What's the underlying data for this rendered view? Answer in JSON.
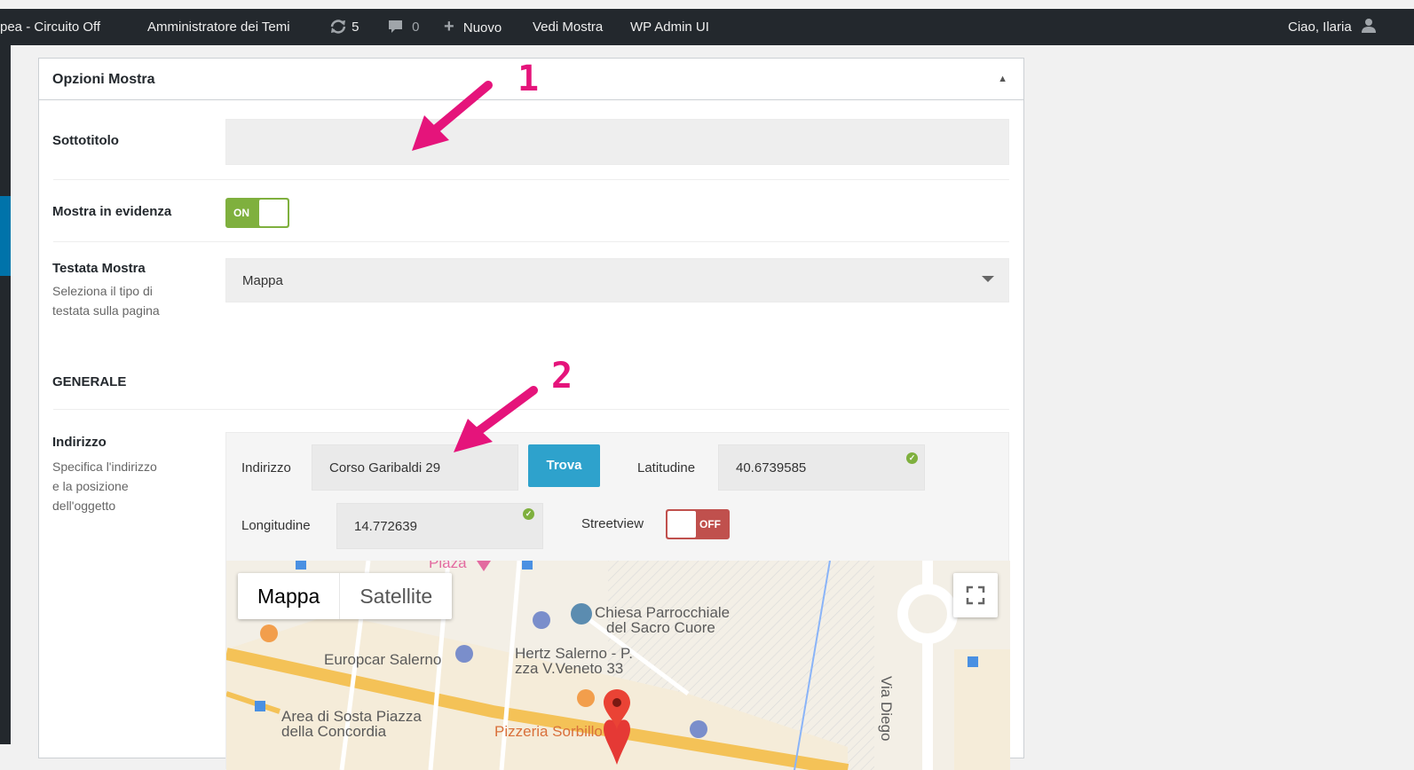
{
  "adminbar": {
    "site": "pea - Circuito Off",
    "theme_admin": "Amministratore dei Temi",
    "updates_count": "5",
    "comments_count": "0",
    "new_label": "Nuovo",
    "view_label": "Vedi Mostra",
    "ui_label": "WP Admin UI",
    "greeting": "Ciao, Ilaria"
  },
  "box": {
    "title": "Opzioni Mostra",
    "fields": {
      "subtitle_label": "Sottotitolo",
      "subtitle_value": "",
      "featured_label": "Mostra in evidenza",
      "featured_toggle": "ON",
      "header_label": "Testata Mostra",
      "header_desc": "Seleziona il tipo di testata sulla pagina",
      "header_value": "Mappa",
      "section_general": "GENERALE",
      "address_label": "Indirizzo",
      "address_desc": "Specifica l'indirizzo e la posizione dell'oggetto"
    },
    "address": {
      "address_field_label": "Indirizzo",
      "address_value": "Corso Garibaldi 29",
      "find_button": "Trova",
      "lat_label": "Latitudine",
      "lat_value": "40.6739585",
      "lng_label": "Longitudine",
      "lng_value": "14.772639",
      "streetview_label": "Streetview",
      "streetview_toggle": "OFF"
    },
    "map": {
      "type_map": "Mappa",
      "type_satellite": "Satellite",
      "labels": {
        "piazza": "Piaza",
        "chiesa_1": "Chiesa Parrocchiale",
        "chiesa_2": "del Sacro Cuore",
        "europcar": "Europcar Salerno",
        "hertz_1": "Hertz Salerno - P.",
        "hertz_2": "zza V.Veneto 33",
        "area_1": "Area di Sosta Piazza",
        "area_2": "della Concordia",
        "pizzeria": "Pizzeria Sorbillo",
        "via_diego": "Via Diego"
      }
    }
  },
  "annotations": {
    "one": "1",
    "two": "2"
  },
  "colors": {
    "annotation": "#e5147b",
    "toggle_on": "#7fb03e",
    "toggle_off": "#c0504d",
    "button": "#2ea2cc"
  }
}
